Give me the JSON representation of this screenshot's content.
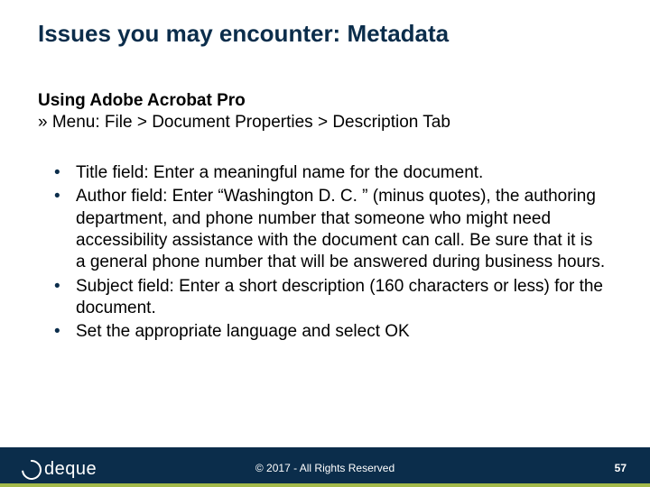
{
  "title": "Issues you may encounter: Metadata",
  "subtitle": {
    "line1": "Using Adobe Acrobat Pro",
    "line2": "» Menu: File > Document Properties > Description Tab"
  },
  "bullets": [
    "Title field: Enter a meaningful name for the document.",
    "Author field: Enter “Washington D. C. ” (minus quotes), the authoring department, and phone number that someone who might need accessibility assistance with the document can call. Be sure that it is a general phone number that will be answered during business hours.",
    "Subject field: Enter a short description (160 characters or less) for the document.",
    "Set the appropriate language and select OK"
  ],
  "footer": {
    "logo_text": "deque",
    "copyright": "© 2017 - All Rights Reserved",
    "page_number": "57"
  }
}
